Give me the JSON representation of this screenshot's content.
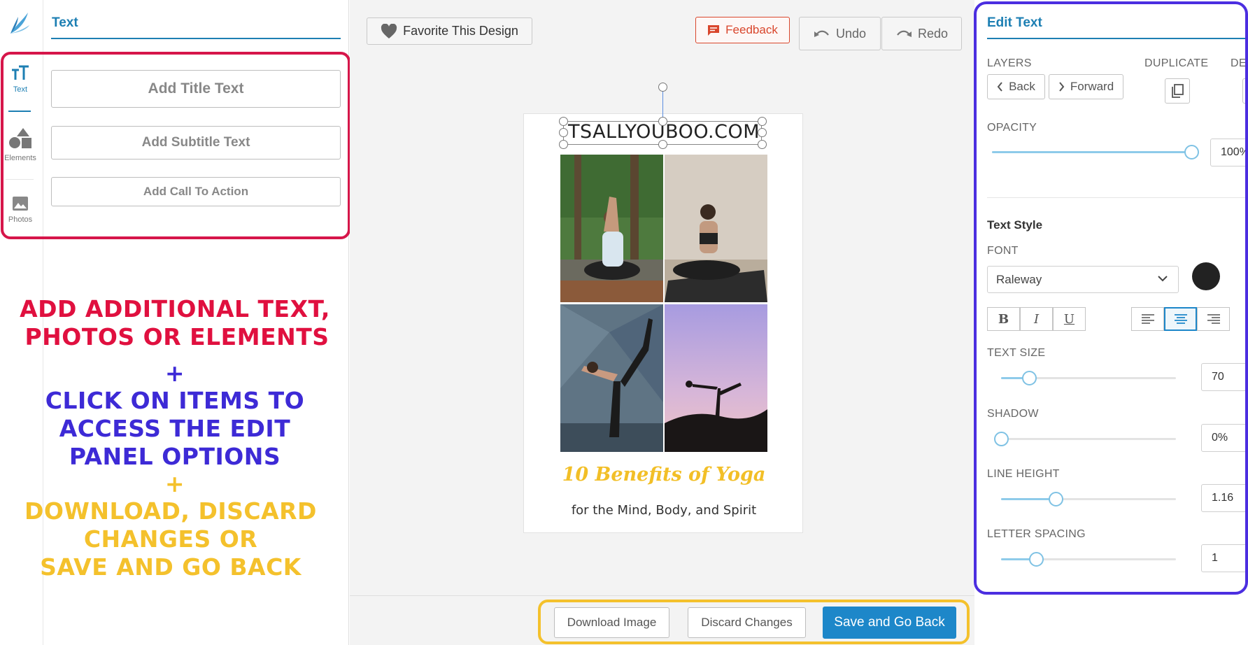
{
  "left_rail": {
    "items": [
      {
        "label": "Text",
        "icon": "text-icon"
      },
      {
        "label": "Elements",
        "icon": "shapes-icon"
      },
      {
        "label": "Photos",
        "icon": "image-icon"
      }
    ]
  },
  "left_panel": {
    "title": "Text",
    "add_title": "Add Title Text",
    "add_subtitle": "Add Subtitle Text",
    "add_cta": "Add Call To Action"
  },
  "instructions": {
    "line1": "ADD ADDITIONAL TEXT,",
    "line2": "PHOTOS OR ELEMENTS",
    "plus1": "+",
    "line3": "CLICK ON ITEMS TO",
    "line4": "ACCESS THE EDIT",
    "line5": "PANEL OPTIONS",
    "plus2": "+",
    "line6": "DOWNLOAD, DISCARD",
    "line7": "CHANGES OR",
    "line8": "SAVE AND GO BACK"
  },
  "toolbar": {
    "favorite": "Favorite This Design",
    "feedback": "Feedback",
    "undo": "Undo",
    "redo": "Redo"
  },
  "design": {
    "url_text": "TSALLYOUBOO.COM",
    "title": "10 Benefits of Yoga",
    "subtitle": "for the Mind, Body, and Spirit"
  },
  "bottom_bar": {
    "download": "Download Image",
    "discard": "Discard Changes",
    "save": "Save and Go Back"
  },
  "edit_panel": {
    "title": "Edit Text",
    "layers_label": "LAYERS",
    "back": "Back",
    "forward": "Forward",
    "duplicate_label": "DUPLICATE",
    "delete_label_partial": "DE",
    "opacity_label": "OPACITY",
    "opacity_value": "100%",
    "opacity": 1.0,
    "text_style_heading": "Text Style",
    "font_label": "FONT",
    "font_value": "Raleway",
    "font_color": "#222222",
    "bold": "B",
    "italic": "I",
    "underline": "U",
    "alignment_selected": "center",
    "text_size_label": "TEXT SIZE",
    "text_size_value": "70",
    "text_size_fraction": 0.16,
    "shadow_label": "SHADOW",
    "shadow_value": "0%",
    "shadow_fraction": 0.0,
    "line_height_label": "LINE HEIGHT",
    "line_height_value": "1.16",
    "line_height_fraction": 0.31,
    "letter_spacing_label": "LETTER SPACING",
    "letter_spacing_value": "1",
    "letter_spacing_fraction": 0.2
  },
  "colors": {
    "accent": "#1d7fb3",
    "save_button": "#1d87c9",
    "feedback": "#d9462c",
    "callout_red": "#d6164a",
    "callout_blue": "#4b2ee0",
    "callout_yellow": "#f4c12c",
    "design_title": "#f2bf27"
  }
}
